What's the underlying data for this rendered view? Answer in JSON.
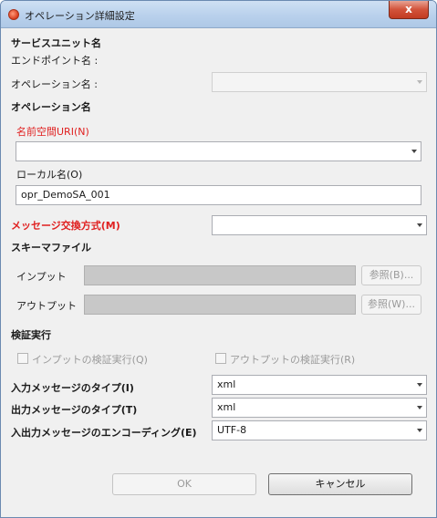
{
  "window": {
    "title": "オペレーション詳細設定",
    "close_label": "x"
  },
  "service": {
    "section_label": "サービスユニット名",
    "endpoint_label": "エンドポイント名 :",
    "operation_name_label": "オペレーション名 :",
    "operation_name_value": ""
  },
  "operation": {
    "section_label": "オペレーション名",
    "namespace_label": "名前空間URI(N)",
    "namespace_value": "",
    "local_name_label": "ローカル名(O)",
    "local_name_value": "opr_DemoSA_001",
    "mep_label": "メッセージ交換方式(M)",
    "mep_value": ""
  },
  "schema": {
    "section_label": "スキーマファイル",
    "input_label": "インプット",
    "input_browse": "参照(B)...",
    "output_label": "アウトプット",
    "output_browse": "参照(W)..."
  },
  "validation": {
    "section_label": "検証実行",
    "input_check": "インプットの検証実行(Q)",
    "output_check": "アウトプットの検証実行(R)"
  },
  "messages": {
    "input_type_label": "入力メッセージのタイプ(I)",
    "input_type_value": "xml",
    "output_type_label": "出力メッセージのタイプ(T)",
    "output_type_value": "xml",
    "encoding_label": "入出力メッセージのエンコーディング(E)",
    "encoding_value": "UTF-8"
  },
  "buttons": {
    "ok": "OK",
    "cancel": "キャンセル"
  },
  "colors": {
    "required_label": "#e02020",
    "disabled_text": "#9a9a9a"
  }
}
